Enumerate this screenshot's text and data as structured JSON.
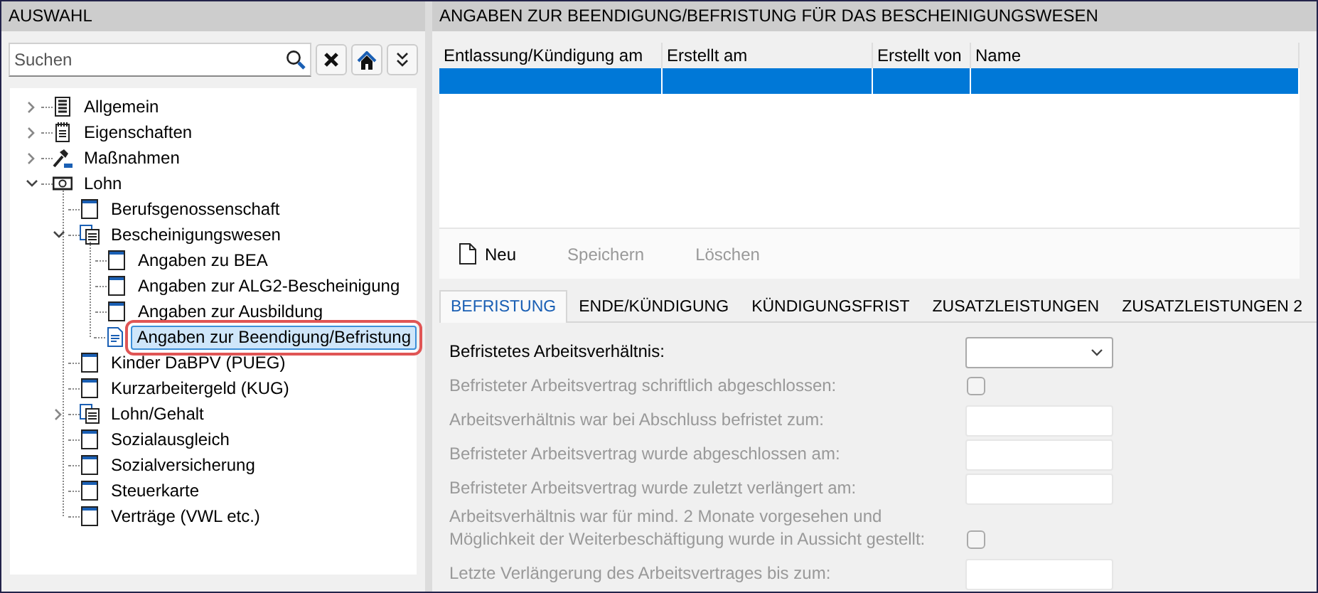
{
  "sidebar": {
    "title": "AUSWAHL",
    "search": {
      "placeholder": "Suchen"
    },
    "tree": [
      {
        "label": "Allgemein",
        "kind": "category",
        "expanded": false,
        "selected": false
      },
      {
        "label": "Eigenschaften",
        "kind": "properties",
        "expanded": false,
        "selected": false
      },
      {
        "label": "Maßnahmen",
        "kind": "actions",
        "expanded": false,
        "selected": false
      },
      {
        "label": "Lohn",
        "kind": "wage",
        "expanded": true,
        "selected": false,
        "children": [
          {
            "label": "Berufsgenossenschaft",
            "kind": "form",
            "selected": false
          },
          {
            "label": "Bescheinigungswesen",
            "kind": "section",
            "expanded": true,
            "selected": false,
            "children": [
              {
                "label": "Angaben zu BEA",
                "kind": "form",
                "selected": false
              },
              {
                "label": "Angaben zur ALG2-Bescheinigung",
                "kind": "form",
                "selected": false
              },
              {
                "label": "Angaben zur Ausbildung",
                "kind": "form",
                "selected": false
              },
              {
                "label": "Angaben zur Beendigung/Befristung",
                "kind": "document",
                "selected": true
              }
            ]
          },
          {
            "label": "Kinder DaBPV (PUEG)",
            "kind": "form",
            "selected": false
          },
          {
            "label": "Kurzarbeitergeld (KUG)",
            "kind": "form",
            "selected": false
          },
          {
            "label": "Lohn/Gehalt",
            "kind": "section",
            "expanded": false,
            "selected": false
          },
          {
            "label": "Sozialausgleich",
            "kind": "form",
            "selected": false
          },
          {
            "label": "Sozialversicherung",
            "kind": "form",
            "selected": false
          },
          {
            "label": "Steuerkarte",
            "kind": "form",
            "selected": false
          },
          {
            "label": "Verträge (VWL etc.)",
            "kind": "form",
            "selected": false
          }
        ]
      }
    ]
  },
  "main": {
    "title": "ANGABEN ZUR BEENDIGUNG/BEFRISTUNG FÜR DAS BESCHEINIGUNGSWESEN",
    "table": {
      "columns": [
        "Entlassung/Kündigung am",
        "Erstellt am",
        "Erstellt von",
        "Name"
      ],
      "rows": [
        {
          "selected": true
        }
      ]
    },
    "toolbar": [
      {
        "label": "Neu",
        "disabled": false,
        "kind": "new"
      },
      {
        "label": "Speichern",
        "disabled": true,
        "kind": "text"
      },
      {
        "label": "Löschen",
        "disabled": true,
        "kind": "text"
      }
    ],
    "tabs": [
      {
        "label": "BEFRISTUNG",
        "selected": true
      },
      {
        "label": "ENDE/KÜNDIGUNG",
        "selected": false
      },
      {
        "label": "KÜNDIGUNGSFRIST",
        "selected": false
      },
      {
        "label": "ZUSATZLEISTUNGEN",
        "selected": false
      },
      {
        "label": "ZUSATZLEISTUNGEN 2",
        "selected": false
      }
    ],
    "form": [
      {
        "label": "Befristetes Arbeitsverhältnis:",
        "kind": "select",
        "disabled": false
      },
      {
        "label": "Befristeter Arbeitsvertrag schriftlich abgeschlossen:",
        "kind": "checkbox",
        "disabled": true,
        "checked": false
      },
      {
        "label": "Arbeitsverhältnis war bei Abschluss befristet zum:",
        "kind": "date",
        "disabled": true
      },
      {
        "label": "Befristeter Arbeitsvertrag wurde abgeschlossen am:",
        "kind": "date",
        "disabled": true
      },
      {
        "label": "Befristeter Arbeitsvertrag wurde zuletzt verlängert am:",
        "kind": "date",
        "disabled": true
      },
      {
        "label": "Arbeitsverhältnis war für mind. 2 Monate vorgesehen und Möglichkeit der Weiterbeschäftigung wurde in Aussicht gestellt:",
        "kind": "checkbox",
        "disabled": true,
        "checked": false
      },
      {
        "label": "Letzte Verlängerung des Arbeitsvertrages bis zum:",
        "kind": "date",
        "disabled": true
      }
    ]
  }
}
